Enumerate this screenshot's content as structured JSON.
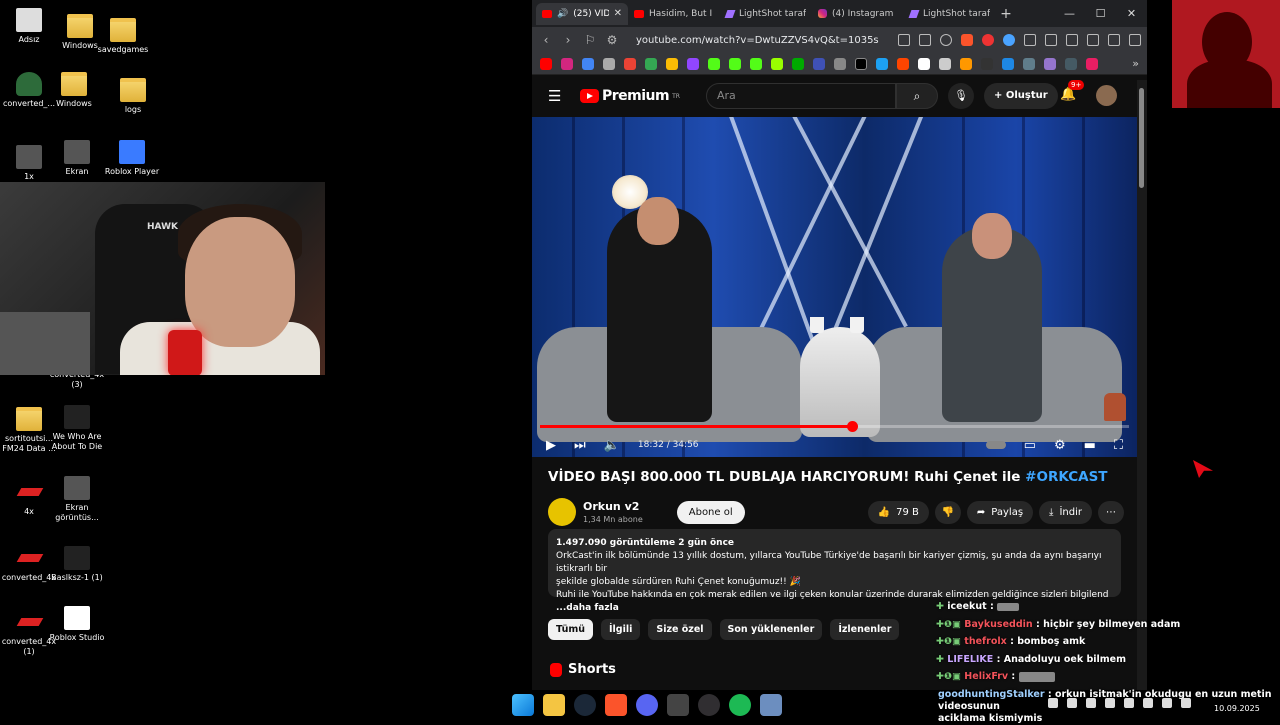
{
  "desktop": {
    "icons": [
      {
        "label": "Adsız"
      },
      {
        "label": "Windows"
      },
      {
        "label": "savedgames"
      },
      {
        "label": "converted_..."
      },
      {
        "label": "Windows"
      },
      {
        "label": "logs"
      },
      {
        "label": "1x"
      },
      {
        "label": "Ekran"
      },
      {
        "label": "Roblox Player"
      },
      {
        "label": "converted_4x (3)"
      },
      {
        "label": "sortitoutsi... FM24 Data ..."
      },
      {
        "label": "We Who Are About To Die"
      },
      {
        "label": "4x"
      },
      {
        "label": "Ekran görüntüs..."
      },
      {
        "label": "converted_4x"
      },
      {
        "label": "Baslksz-1 (1)"
      },
      {
        "label": "converted_4x (1)"
      },
      {
        "label": "Roblox Studio"
      }
    ],
    "webcam_chair_text": "HAWK"
  },
  "browser": {
    "tabs": [
      {
        "label": "(25) VİDEO",
        "active": true
      },
      {
        "label": "Hasidim, But I Do"
      },
      {
        "label": "LightShot tarafınd"
      },
      {
        "label": "(4) Instagram"
      },
      {
        "label": "LightShot tarafınd"
      }
    ],
    "url": "youtube.com/watch?v=DwtuZZVS4vQ&t=1035s"
  },
  "youtube": {
    "brand": "Premium",
    "brand_region": "TR",
    "search_placeholder": "Ara",
    "create_label": "Oluştur",
    "notifications_badge": "9+",
    "player": {
      "time_current": "18:32",
      "time_total": "34:56",
      "time_display": "18:32 / 34:56",
      "progress_fraction": 0.53
    },
    "video": {
      "title": "VİDEO BAŞI 800.000 TL DUBLAJA HARCIYORUM! Ruhi Çenet ile ",
      "hashtag": "#ORKCAST",
      "channel_name": "Orkun v2",
      "subscribers": "1,34 Mn abone",
      "subscribe_label": "Abone ol",
      "likes": "79 B",
      "share_label": "Paylaş",
      "download_label": "İndir",
      "more_label": "⋯"
    },
    "description": {
      "stats": "1.497.090 görüntüleme  2 gün önce",
      "line1": "OrkCast'in ilk bölümünde 13 yıllık dostum, yıllarca YouTube Türkiye'de başarılı bir kariyer çizmiş, şu anda da aynı başarıyı istikrarlı bir",
      "line2": "şekilde globalde sürdüren Ruhi Çenet konuğumuz!! 🎉",
      "line3": "Ruhi ile YouTube hakkında en çok merak edilen ve ilgi çeken konular üzerinde durarak elimizden geldiğince sizleri bilgilend",
      "more": "...daha fazla"
    },
    "chips": [
      "Tümü",
      "İlgili",
      "Size özel",
      "Son yüklenenler",
      "İzlenenler"
    ],
    "shorts_label": "Shorts"
  },
  "chat": {
    "lines": [
      {
        "user": "iceekut",
        "message": "",
        "color": "green"
      },
      {
        "user": "Baykuseddin",
        "message": "hiçbir şey bilmeyen adam",
        "color": "red"
      },
      {
        "user": "thefrolx",
        "message": "bomboş amk",
        "color": "red"
      },
      {
        "user": "LIFELIKE",
        "message": "Anadoluyu oek bilmem",
        "color": "purple"
      },
      {
        "user": "HelixFrv",
        "message": "",
        "color": "red"
      }
    ],
    "bottom": {
      "user": "goodhuntingStalker",
      "message": "orkun isitmak'in okudugu en uzun metin videosunun",
      "message2": "aciklama kismiymis"
    }
  },
  "taskbar": {
    "date": "10.09.2025",
    "discord_badge": "29"
  }
}
